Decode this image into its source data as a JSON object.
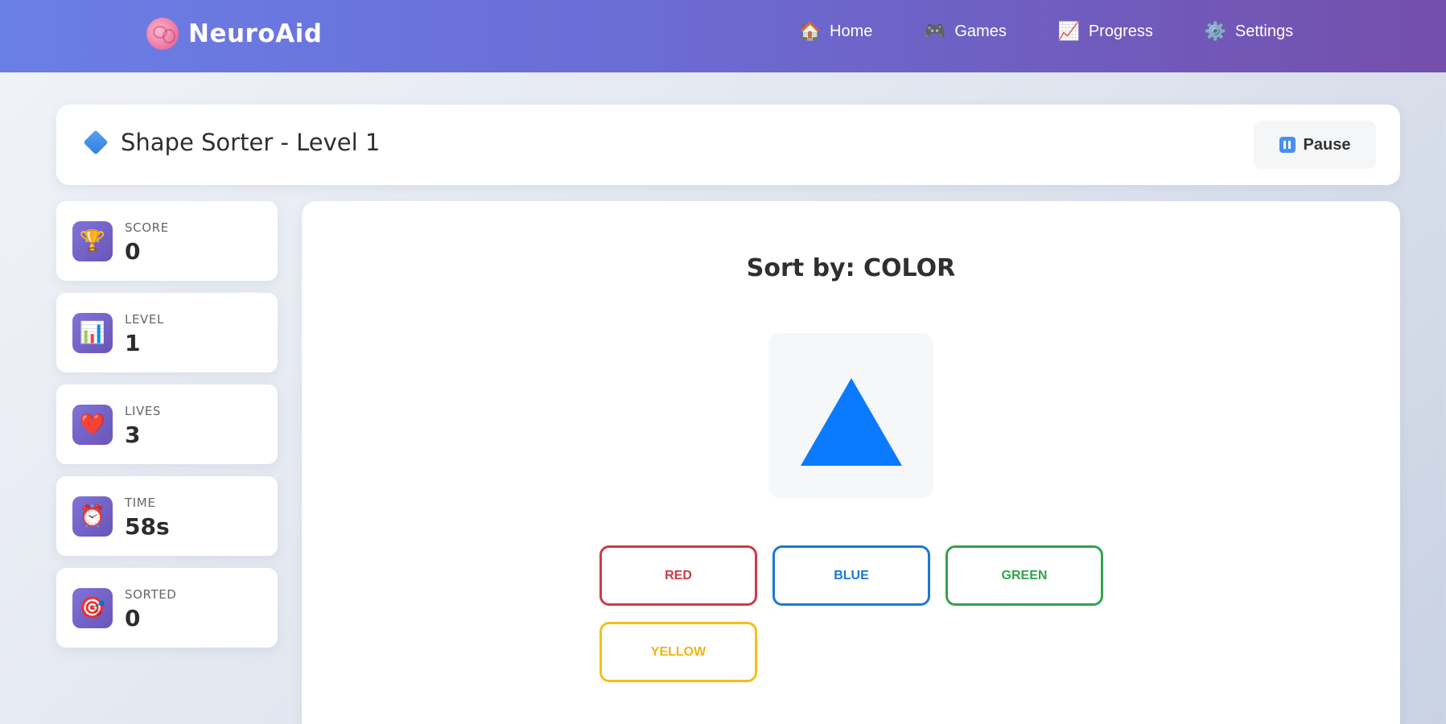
{
  "app": {
    "name": "NeuroAid",
    "logo_icon": "brain-icon"
  },
  "nav": {
    "items": [
      {
        "label": "Home",
        "icon": "🏠"
      },
      {
        "label": "Games",
        "icon": "🎮"
      },
      {
        "label": "Progress",
        "icon": "📈"
      },
      {
        "label": "Settings",
        "icon": "⚙️"
      }
    ]
  },
  "game": {
    "title": "Shape Sorter - Level 1",
    "pause_label": "Pause",
    "prompt": "Sort by: COLOR",
    "current_shape": {
      "type": "triangle",
      "color": "#0a7bff"
    },
    "options": [
      {
        "label": "RED",
        "color": "#cf3a46"
      },
      {
        "label": "BLUE",
        "color": "#1a78d8"
      },
      {
        "label": "GREEN",
        "color": "#32a24c"
      },
      {
        "label": "YELLOW",
        "color": "#f2c018"
      }
    ]
  },
  "stats": [
    {
      "label": "SCORE",
      "value": "0",
      "icon": "🏆"
    },
    {
      "label": "LEVEL",
      "value": "1",
      "icon": "📊"
    },
    {
      "label": "LIVES",
      "value": "3",
      "icon": "❤️"
    },
    {
      "label": "TIME",
      "value": "58s",
      "icon": "⏰"
    },
    {
      "label": "SORTED",
      "value": "0",
      "icon": "🎯"
    }
  ],
  "colors": {
    "header_start": "#6a7fe6",
    "header_end": "#744fab",
    "stat_icon_bg": "#7e73d9"
  }
}
